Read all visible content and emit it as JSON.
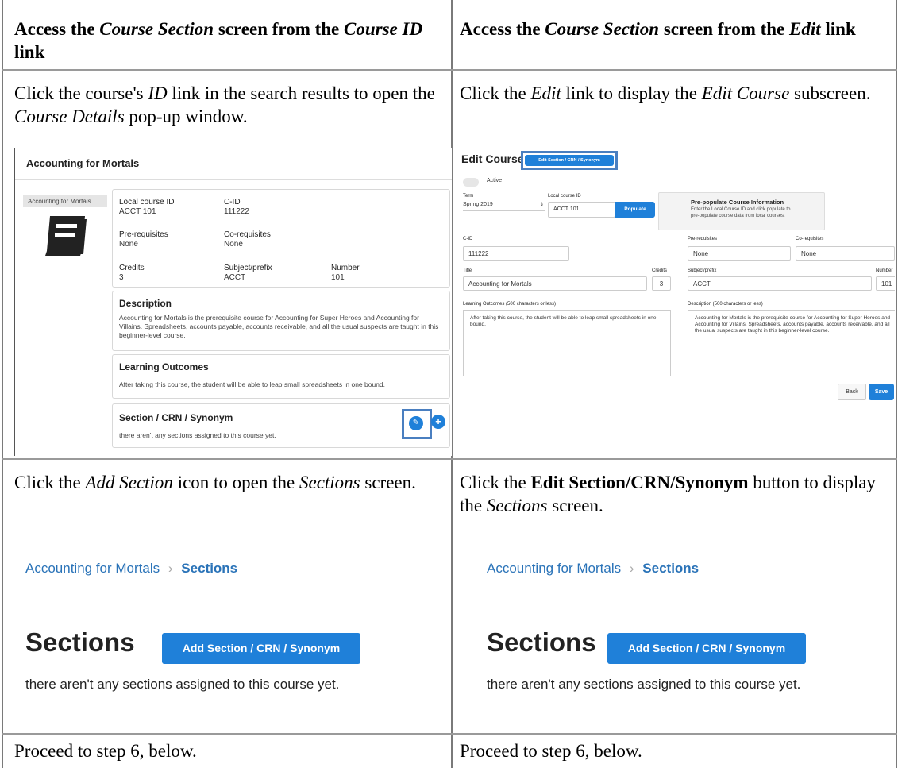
{
  "header": {
    "left_prefix": "Access the ",
    "left_em1": "Course Section",
    "left_mid": " screen from the ",
    "left_em2": "Course ID",
    "left_suffix": " link",
    "right_prefix": "Access the ",
    "right_em1": "Course Section",
    "right_mid": " screen from the ",
    "right_em2": "Edit",
    "right_suffix": " link"
  },
  "row1": {
    "left_a": "Click the course's ",
    "left_em1": "ID",
    "left_b": " link in the search results to open the ",
    "left_em2": "Course Details",
    "left_c": " pop-up window.",
    "right_a": "Click the ",
    "right_em1": "Edit",
    "right_b": " link to display the ",
    "right_em2": "Edit Course",
    "right_c": " subscreen."
  },
  "details_shot": {
    "title": "Accounting for Mortals",
    "tag": "Accounting for Mortals",
    "local_id_label": "Local course ID",
    "local_id_value": "ACCT 101",
    "cid_label": "C-ID",
    "cid_value": "111222",
    "prereq_label": "Pre-requisites",
    "prereq_value": "None",
    "coreq_label": "Co-requisites",
    "coreq_value": "None",
    "credits_label": "Credits",
    "credits_value": "3",
    "subject_label": "Subject/prefix",
    "subject_value": "ACCT",
    "number_label": "Number",
    "number_value": "101",
    "desc_heading": "Description",
    "desc_text": "Accounting for Mortals is the prerequisite course for Accounting for Super Heroes and Accounting for Villains. Spreadsheets, accounts payable, accounts receivable, and all the usual suspects are taught in this beginner-level course.",
    "lo_heading": "Learning Outcomes",
    "lo_text": "After taking this course, the student will be able to leap small spreadsheets in one bound.",
    "sec_heading": "Section / CRN / Synonym",
    "sec_text": "there aren't any sections assigned to this course yet."
  },
  "edit_shot": {
    "title": "Edit Course",
    "edit_section_btn": "Edit Section / CRN / Synonym",
    "active_label": "Active",
    "term_label": "Term",
    "term_value": "Spring 2019",
    "local_id_label": "Local course ID",
    "local_id_value": "ACCT 101",
    "populate_btn": "Populate",
    "prepop_title": "Pre-populate Course Information",
    "prepop_text1": "Enter the Local Course ID and click populate to",
    "prepop_text2": "pre-populate course data from local courses.",
    "cid_label": "C-ID",
    "cid_value": "111222",
    "prereq_label": "Pre-requisites",
    "prereq_value": "None",
    "coreq_label": "Co-requisites",
    "coreq_value": "None",
    "title_label": "Title",
    "title_value": "Accounting for Mortals",
    "credits_label": "Credits",
    "credits_value": "3",
    "subject_label": "Subject/prefix",
    "subject_value": "ACCT",
    "number_label": "Number",
    "number_value": "101",
    "lo_label": "Learning Outcomes (500 characters or less)",
    "lo_value": "After taking this course, the student will be able to leap small spreadsheets in one bound.",
    "desc_label": "Description (500 characters or less)",
    "desc_value": "Accounting for Mortals is the prerequisite course for Accounting for Super Heroes and Accounting for Villains. Spreadsheets, accounts payable, accounts receivable, and all the usual suspects are taught in this beginner-level course.",
    "back_btn": "Back",
    "save_btn": "Save"
  },
  "row2": {
    "left_a": "Click the ",
    "left_em1": "Add Section",
    "left_b": " icon to open the ",
    "left_em2": "Sections",
    "left_c": " screen.",
    "right_a": "Click the ",
    "right_bold": "Edit Section/CRN/Synonym",
    "right_b": " button to display the ",
    "right_em": "Sections",
    "right_c": " screen."
  },
  "sections_shot": {
    "crumb_parent": "Accounting for Mortals",
    "crumb_sep": "›",
    "crumb_current": "Sections",
    "heading": "Sections",
    "add_btn": "Add Section / CRN / Synonym",
    "empty_text": "there aren't any sections assigned to this course yet."
  },
  "row3": {
    "left": "Proceed to step 6, below.",
    "right": "Proceed to step 6, below."
  },
  "colors": {
    "accent": "#1f80d9",
    "highlight": "#4a7fc0",
    "link": "#2a73b8"
  }
}
